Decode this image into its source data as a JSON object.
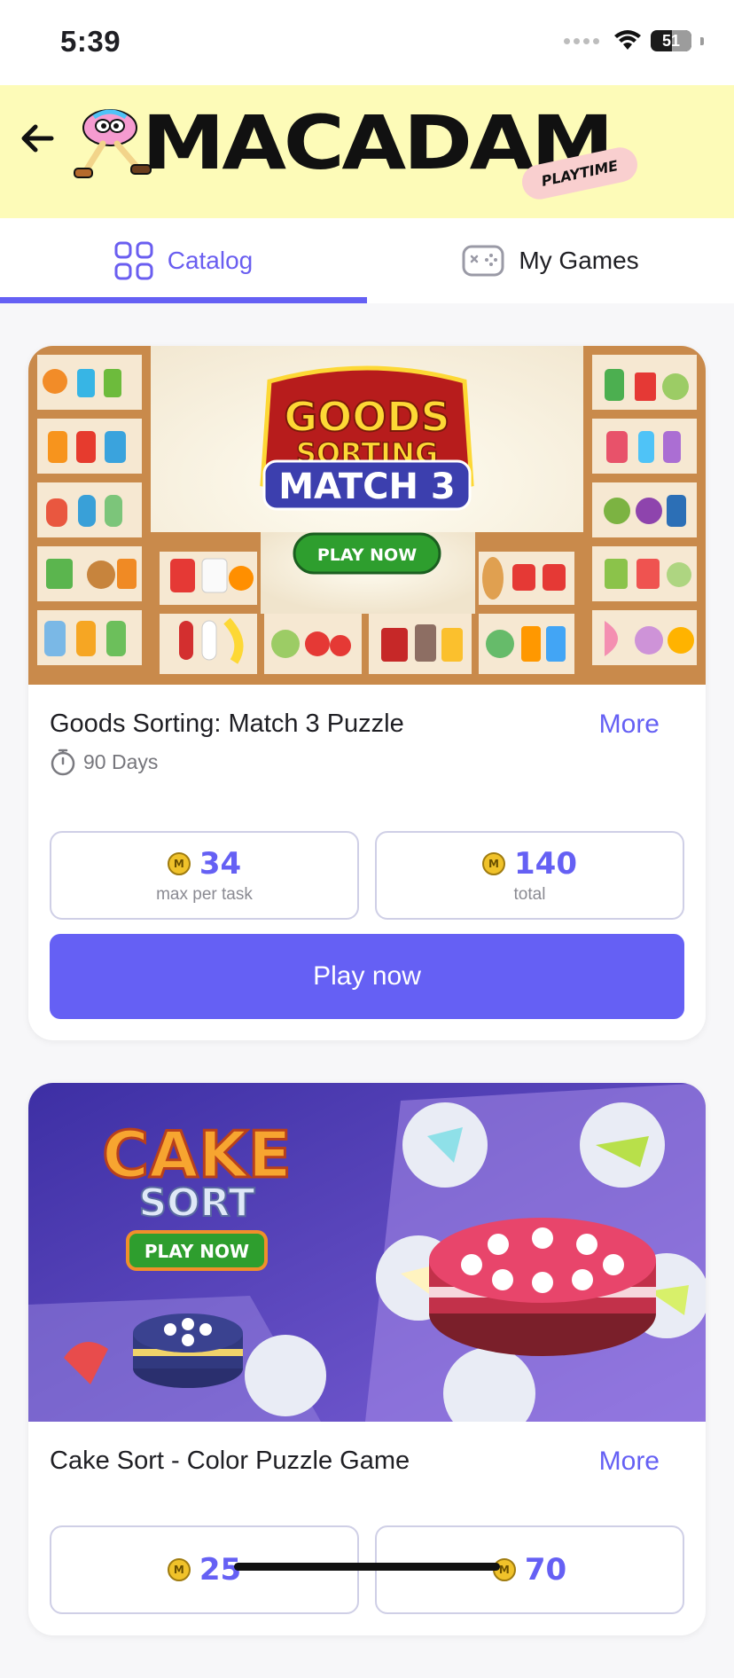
{
  "status_bar": {
    "time": "5:39",
    "battery_level": "51"
  },
  "header": {
    "brand": "MACADAM",
    "brand_tagline": "PLAYTIME"
  },
  "tabs": [
    {
      "label": "Catalog",
      "icon": "grid-icon",
      "active": true
    },
    {
      "label": "My Games",
      "icon": "gamepad-icon",
      "active": false
    }
  ],
  "games": [
    {
      "title": "Goods Sorting: Match 3 Puzzle",
      "more_label": "More",
      "duration": "90 Days",
      "banner": {
        "line1": "GOODS",
        "line2": "SORTING",
        "line3": "MATCH 3",
        "cta": "PLAY NOW"
      },
      "max_per_task": "34",
      "max_per_task_label": "max per task",
      "total": "140",
      "total_label": "total",
      "play_label": "Play now"
    },
    {
      "title": "Cake Sort - Color Puzzle Game",
      "more_label": "More",
      "banner": {
        "line1": "CAKE",
        "line2": "SORT",
        "cta": "PLAY NOW"
      },
      "max_per_task": "25",
      "total": "70"
    }
  ],
  "colors": {
    "accent": "#6560f4",
    "header_bg": "#fdfbb8",
    "coin": "#f0c22a"
  }
}
